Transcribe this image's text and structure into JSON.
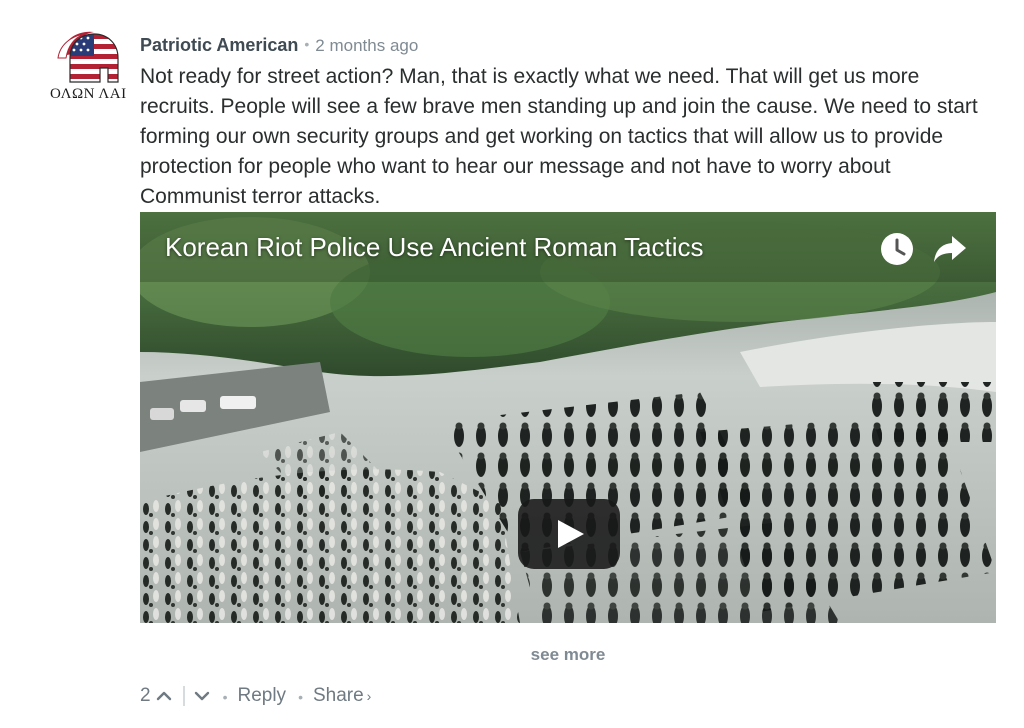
{
  "comment": {
    "author": "Patriotic American",
    "separator": "•",
    "timestamp": "2 months ago",
    "avatar": {
      "icon": "spartan-helmet-flag-icon",
      "motto": "ΟΛΩΝ ΛΑΙ"
    },
    "body": "Not ready for street action? Man, that is exactly what we need. That will get us more recruits. People will see a few brave men standing up and join the cause. We need to start forming our own security groups and get working on tactics that will allow us to provide protection for people who want to hear our message and not have to worry about Communist terror attacks."
  },
  "video": {
    "title": "Korean Riot Police Use Ancient Roman Tactics",
    "icons": {
      "watch_later": "clock-icon",
      "share": "share-arrow-icon",
      "play": "play-icon"
    }
  },
  "see_more_label": "see more",
  "footer": {
    "vote_count": "2",
    "upvote_icon": "chevron-up-icon",
    "downvote_icon": "chevron-down-icon",
    "dot": "•",
    "reply_label": "Reply",
    "share_label": "Share",
    "share_chevron": "›"
  },
  "colors": {
    "author": "#3f4a52",
    "meta": "#7f8a92",
    "body_text": "#2a2e2e",
    "play_button_bg": "#181818"
  }
}
